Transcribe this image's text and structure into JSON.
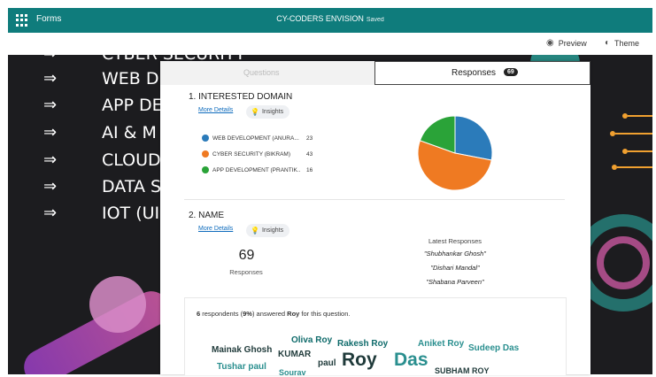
{
  "topbar": {
    "app_name": "Forms",
    "form_title": "CY-CODERS ENVISION",
    "status": "Saved"
  },
  "toolbar": {
    "preview_label": "Preview",
    "theme_label": "Theme",
    "preview_icon": "eye-icon",
    "theme_icon": "palette-icon"
  },
  "background": {
    "items": [
      "CYBER SECURITY",
      "WEB DEVELOPMENT",
      "APP DE",
      "AI & M",
      "CLOUD",
      "DATA S",
      "IOT (UI"
    ],
    "arrow": "⇒"
  },
  "tabs": {
    "questions_label": "Questions",
    "responses_label": "Responses",
    "responses_count": "69"
  },
  "q1": {
    "title": "1. INTERESTED DOMAIN",
    "more_details": "More Details",
    "insights": "Insights",
    "options": [
      {
        "label": "WEB DEVELOPMENT (ANURA...",
        "count": 23,
        "color": "#2b7bba"
      },
      {
        "label": "CYBER SECURITY (BIKRAM)",
        "count": 43,
        "color": "#ef7a22"
      },
      {
        "label": "APP DEVELOPMENT (PRANTIK...",
        "count": 16,
        "color": "#2aa338"
      }
    ]
  },
  "q2": {
    "title": "2. NAME",
    "more_details": "More Details",
    "insights": "Insights",
    "response_count": "69",
    "responses_label": "Responses",
    "latest_heading": "Latest Responses",
    "latest": [
      "\"Shubhankar Ghosh\"",
      "\"Dishari Mandal\"",
      "\"Shabana Parveen\""
    ],
    "summary": {
      "respondents": "6",
      "percent": "9%",
      "word": "Roy",
      "text_a": " respondents (",
      "text_b": ") answered ",
      "text_c": " for this question."
    },
    "words": [
      "Oliva Roy",
      "Rakesh Roy",
      "Aniket Roy",
      "Sudeep Das",
      "Mainak Ghosh",
      "KUMAR",
      "Tushar paul",
      "paul",
      "Roy",
      "Das",
      "SUBHAM ROY",
      "Sourav"
    ]
  }
}
